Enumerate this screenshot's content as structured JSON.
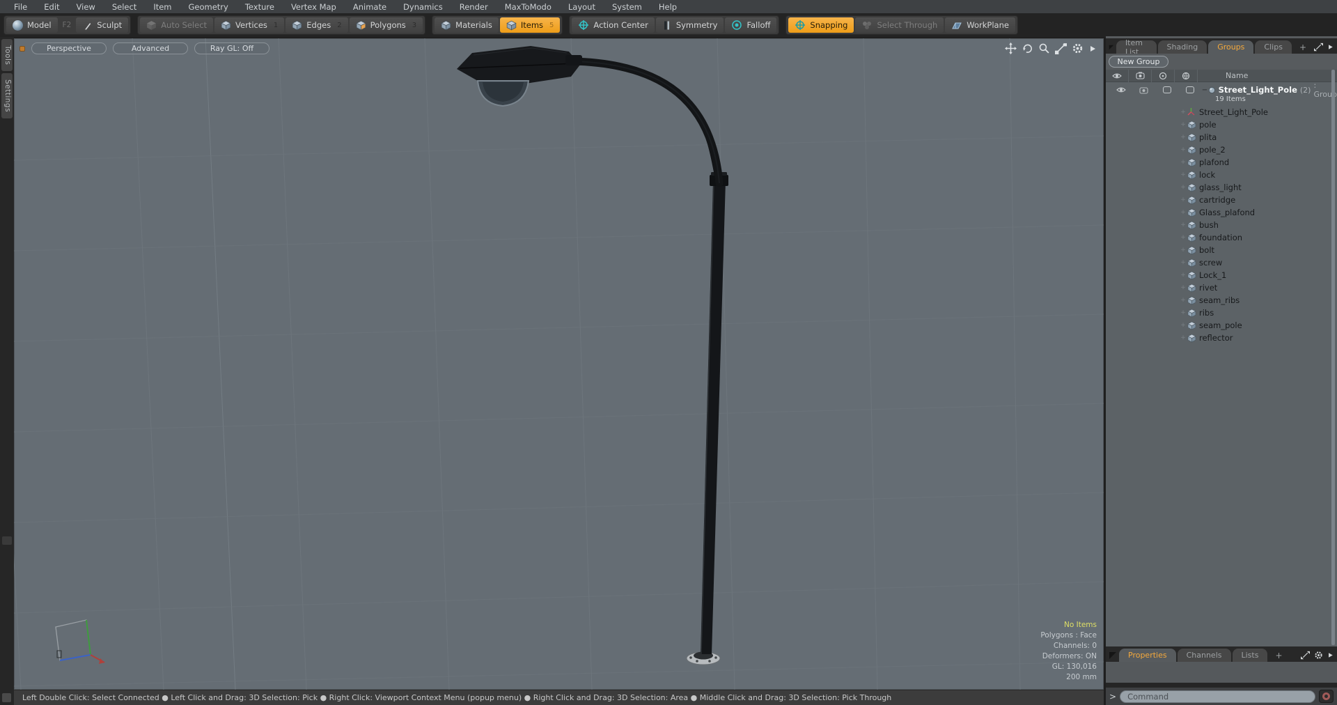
{
  "menu_bar": {
    "items": [
      "File",
      "Edit",
      "View",
      "Select",
      "Item",
      "Geometry",
      "Texture",
      "Vertex Map",
      "Animate",
      "Dynamics",
      "Render",
      "MaxToModo",
      "Layout",
      "System",
      "Help"
    ]
  },
  "toolbar": {
    "model": "Model",
    "model_shortcut": "F2",
    "sculpt": "Sculpt",
    "auto_select": "Auto Select",
    "vertices": "Vertices",
    "vertices_key": "1",
    "edges": "Edges",
    "edges_key": "2",
    "polygons": "Polygons",
    "polygons_key": "3",
    "materials": "Materials",
    "items": "Items",
    "items_key": "5",
    "action_center": "Action Center",
    "symmetry": "Symmetry",
    "falloff": "Falloff",
    "snapping": "Snapping",
    "select_through": "Select Through",
    "workplane": "WorkPlane",
    "accent_orange": "#f0a32e"
  },
  "side_tabs": {
    "tools": "Tools",
    "settings": "Settings"
  },
  "viewport": {
    "bg_color": "#656d74",
    "view_mode": "Perspective",
    "shading_mode": "Advanced",
    "ray_gl": "Ray GL: Off",
    "stats": {
      "selection": "No Items",
      "polygons": "Polygons : Face",
      "channels": "Channels: 0",
      "deformers": "Deformers: ON",
      "gl": "GL: 130,016",
      "grid_size": "200 mm"
    }
  },
  "right_panel": {
    "tabs": [
      "Item List",
      "Shading",
      "Groups",
      "Clips"
    ],
    "active_tab": "Groups",
    "add_tab_label": "+",
    "new_group_label": "New Group",
    "name_header": "Name",
    "group_row": {
      "expander": "−",
      "name": "Street_Light_Pole",
      "count": "(2)",
      "type_suffix": ": Group",
      "subtitle": "19 Items"
    },
    "item_expander": "+",
    "items": [
      {
        "label": "Street_Light_Pole",
        "icon": "locator"
      },
      {
        "label": "pole",
        "icon": "mesh"
      },
      {
        "label": "plita",
        "icon": "mesh"
      },
      {
        "label": "pole_2",
        "icon": "mesh"
      },
      {
        "label": "plafond",
        "icon": "mesh"
      },
      {
        "label": "lock",
        "icon": "mesh"
      },
      {
        "label": "glass_light",
        "icon": "mesh"
      },
      {
        "label": "cartridge",
        "icon": "mesh"
      },
      {
        "label": "Glass_plafond",
        "icon": "mesh"
      },
      {
        "label": "bush",
        "icon": "mesh"
      },
      {
        "label": "foundation",
        "icon": "mesh"
      },
      {
        "label": "bolt",
        "icon": "mesh"
      },
      {
        "label": "screw",
        "icon": "mesh"
      },
      {
        "label": "Lock_1",
        "icon": "mesh"
      },
      {
        "label": "rivet",
        "icon": "mesh"
      },
      {
        "label": "seam_ribs",
        "icon": "mesh"
      },
      {
        "label": "ribs",
        "icon": "mesh"
      },
      {
        "label": "seam_pole",
        "icon": "mesh"
      },
      {
        "label": "reflector",
        "icon": "mesh"
      }
    ]
  },
  "bottom_panel": {
    "tabs": [
      "Properties",
      "Channels",
      "Lists"
    ],
    "active_tab": "Properties",
    "add_tab_label": "+",
    "prompt": ">",
    "command_placeholder": "Command"
  },
  "status_bar": {
    "text": "Left Double Click: Select Connected ● Left Click and Drag: 3D Selection: Pick ● Right Click: Viewport Context Menu (popup menu) ● Right Click and Drag: 3D Selection: Area ● Middle Click and Drag: 3D Selection: Pick Through"
  }
}
